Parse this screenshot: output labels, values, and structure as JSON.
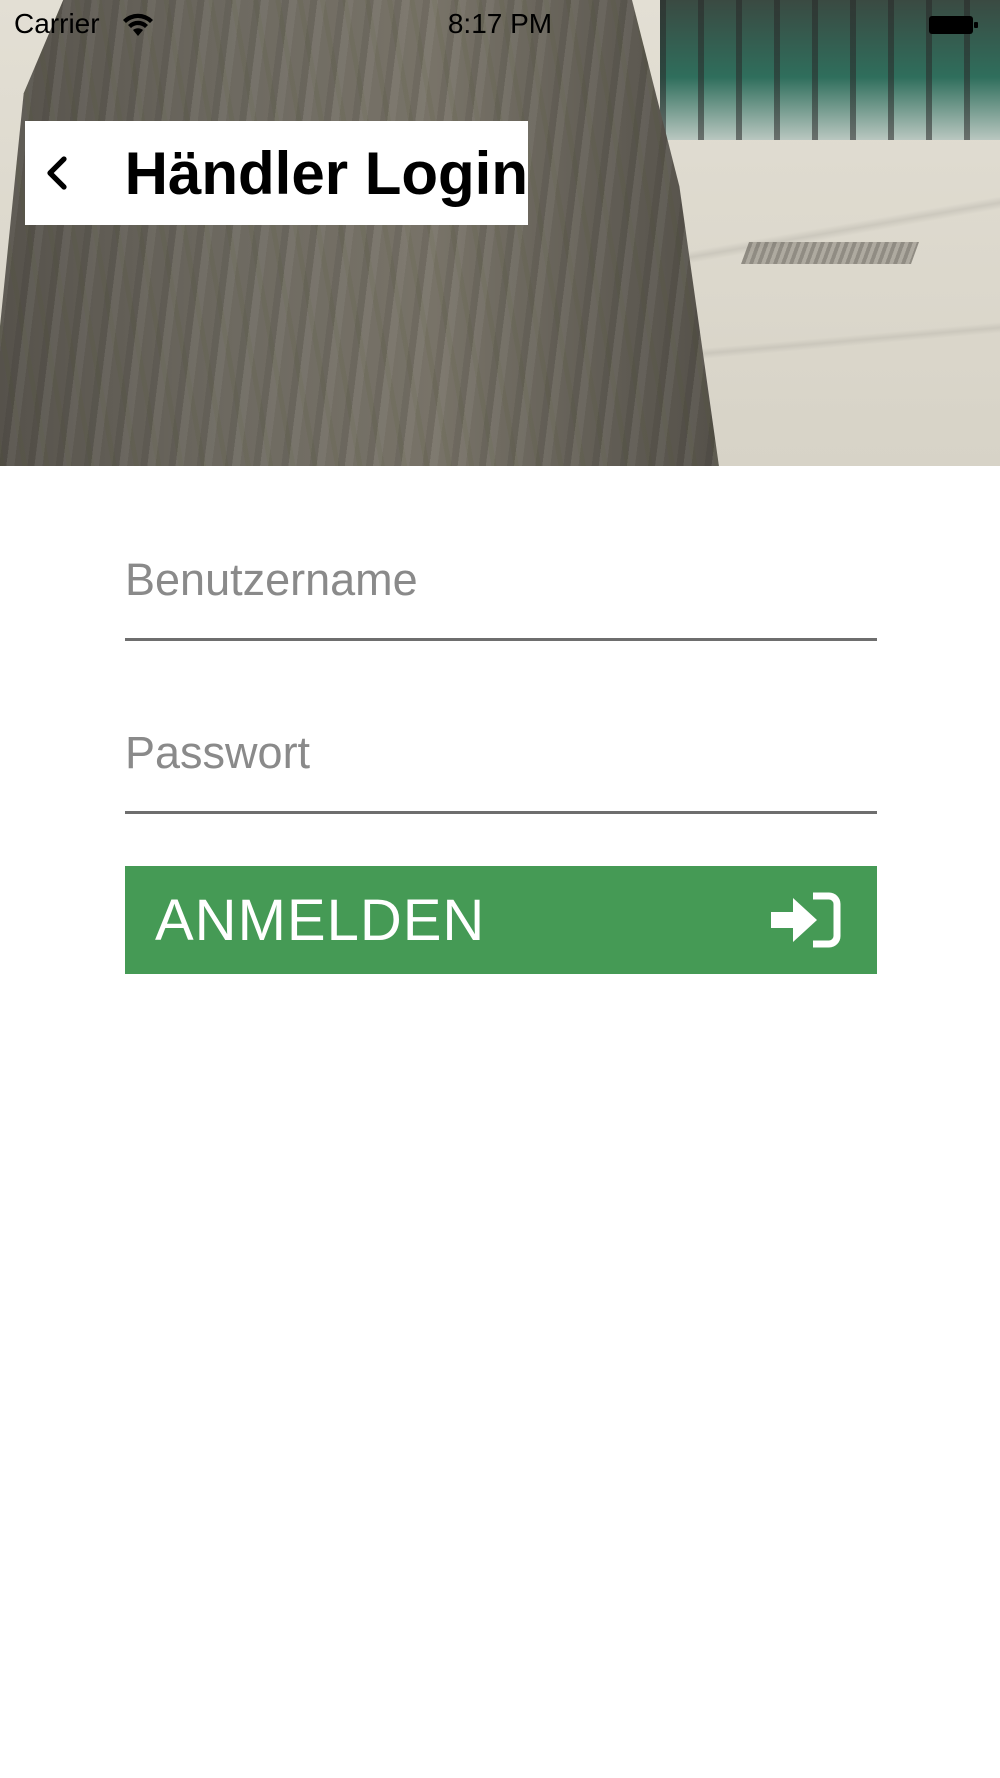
{
  "status_bar": {
    "carrier": "Carrier",
    "time": "8:17 PM"
  },
  "header": {
    "title": "Händler Login"
  },
  "form": {
    "username_placeholder": "Benutzername",
    "password_placeholder": "Passwort",
    "login_label": "ANMELDEN"
  },
  "colors": {
    "accent": "#459a55",
    "field_underline": "#6e6e6e",
    "placeholder": "#8a8a8a"
  },
  "icons": {
    "back": "chevron-left-icon",
    "login": "sign-in-icon",
    "wifi": "wifi-icon",
    "battery": "battery-icon"
  }
}
